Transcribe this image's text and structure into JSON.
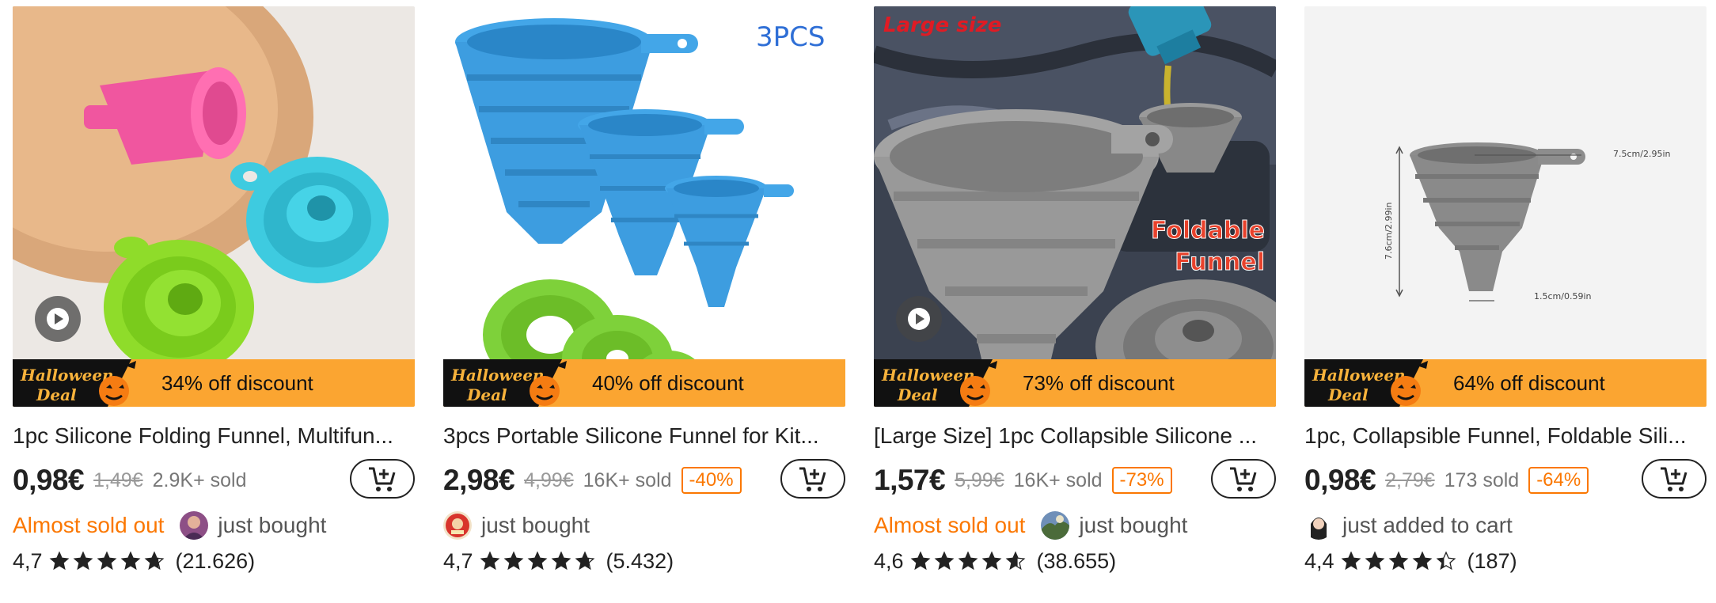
{
  "products": [
    {
      "title": "1pc Silicone Folding Funnel, Multifun...",
      "badge": "34% off discount",
      "price": "0,98€",
      "old_price": "1,49€",
      "sold": "2.9K+ sold",
      "discount_tag": "",
      "urgency": "Almost sold out",
      "activity": "just bought",
      "rating": "4,7",
      "rating_value": 4.7,
      "reviews": "(21.626)",
      "has_video": true
    },
    {
      "title": "3pcs Portable Silicone Funnel for Kit...",
      "badge": "40% off discount",
      "price": "2,98€",
      "old_price": "4,99€",
      "sold": "16K+ sold",
      "discount_tag": "-40%",
      "urgency": "",
      "activity": "just bought",
      "rating": "4,7",
      "rating_value": 4.7,
      "reviews": "(5.432)",
      "has_video": false,
      "image_text": "3PCS"
    },
    {
      "title": "[Large Size] 1pc Collapsible Silicone ...",
      "badge": "73% off discount",
      "price": "1,57€",
      "old_price": "5,99€",
      "sold": "16K+ sold",
      "discount_tag": "-73%",
      "urgency": "Almost sold out",
      "activity": "just bought",
      "rating": "4,6",
      "rating_value": 4.6,
      "reviews": "(38.655)",
      "has_video": true,
      "image_text": "Large size",
      "image_text2": "Foldable",
      "image_text3": "Funnel"
    },
    {
      "title": "1pc, Collapsible Funnel, Foldable Sili...",
      "badge": "64% off discount",
      "price": "0,98€",
      "old_price": "2,79€",
      "sold": "173 sold",
      "discount_tag": "-64%",
      "urgency": "",
      "activity": "just added to cart",
      "rating": "4,4",
      "rating_value": 4.4,
      "reviews": "(187)",
      "has_video": false,
      "dim_top": "7.5cm/2.95in",
      "dim_side": "7.6cm/2.99in",
      "dim_bottom": "1.5cm/0.59in"
    }
  ],
  "halloween_label_1": "Halloween",
  "halloween_label_2": "Deal",
  "colors": {
    "accent": "#fb7701",
    "banner": "#fba531"
  }
}
